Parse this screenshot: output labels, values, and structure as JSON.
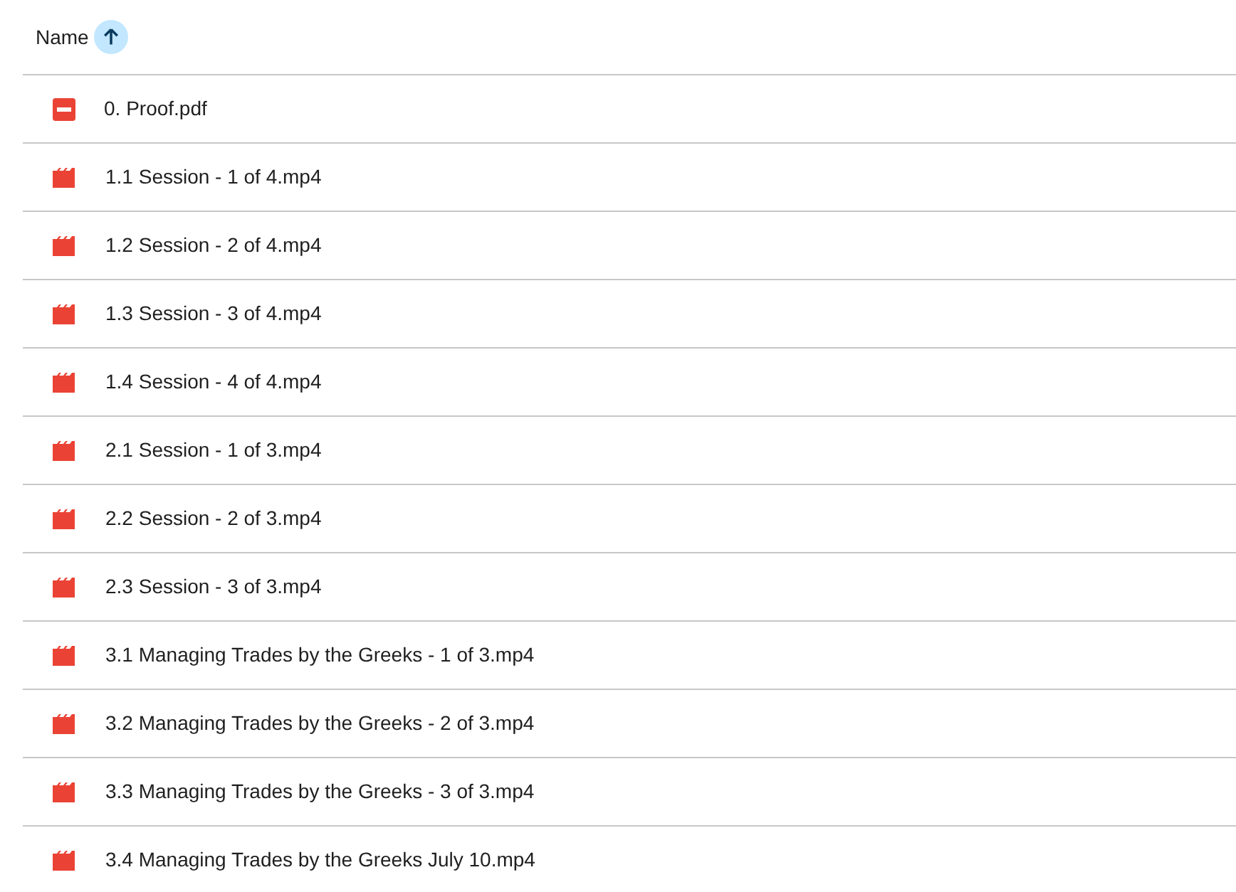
{
  "header": {
    "label": "Name",
    "sort_ascending": true
  },
  "files": [
    {
      "kind": "pdf",
      "name": "0. Proof.pdf"
    },
    {
      "kind": "video",
      "name": "1.1 Session - 1 of 4.mp4"
    },
    {
      "kind": "video",
      "name": "1.2 Session - 2 of 4.mp4"
    },
    {
      "kind": "video",
      "name": "1.3 Session - 3 of 4.mp4"
    },
    {
      "kind": "video",
      "name": "1.4 Session - 4 of 4.mp4"
    },
    {
      "kind": "video",
      "name": "2.1 Session - 1 of 3.mp4"
    },
    {
      "kind": "video",
      "name": "2.2 Session - 2 of 3.mp4"
    },
    {
      "kind": "video",
      "name": "2.3 Session - 3 of 3.mp4"
    },
    {
      "kind": "video",
      "name": "3.1 Managing Trades by the Greeks - 1 of 3.mp4"
    },
    {
      "kind": "video",
      "name": "3.2 Managing Trades by the Greeks - 2 of 3.mp4"
    },
    {
      "kind": "video",
      "name": "3.3 Managing Trades by the Greeks - 3 of 3.mp4"
    },
    {
      "kind": "video",
      "name": "3.4 Managing Trades by the Greeks July 10.mp4"
    }
  ]
}
